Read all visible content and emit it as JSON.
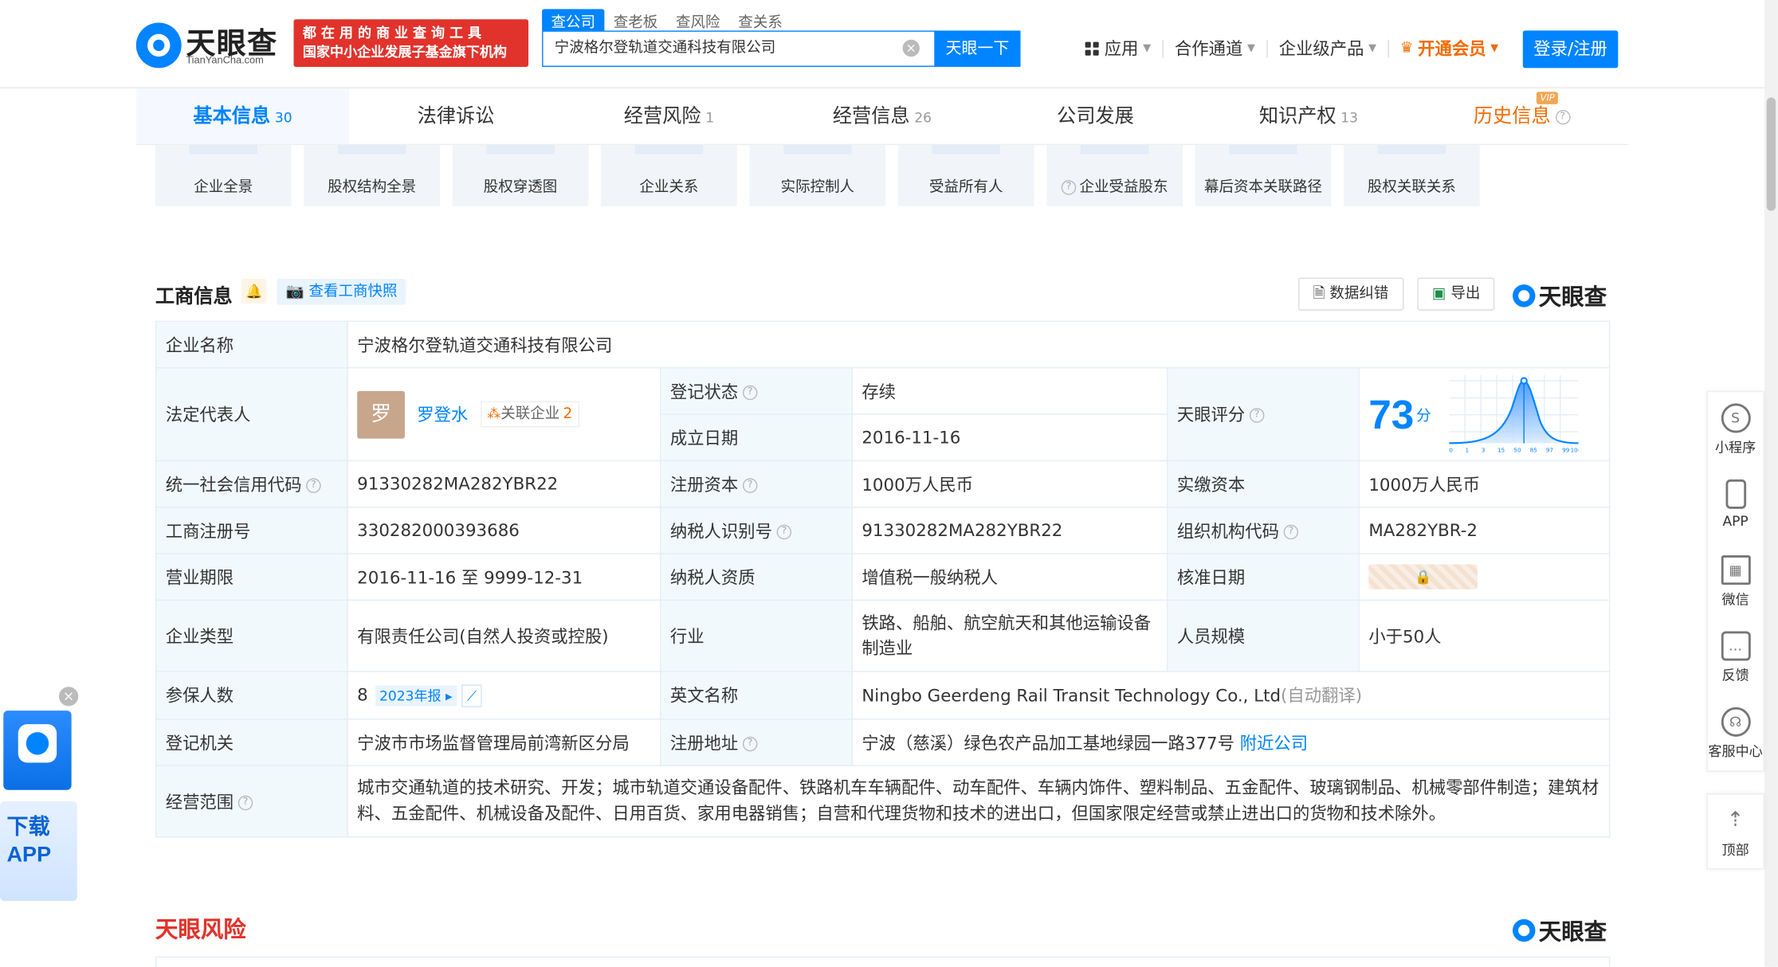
{
  "brand": {
    "name": "天眼查",
    "domain": "TianYanCha.com",
    "slogan_line1": "都 在 用 的 商 业 查 询 工 具",
    "slogan_line2": "国家中小企业发展子基金旗下机构"
  },
  "search": {
    "tabs": [
      "查公司",
      "查老板",
      "查风险",
      "查关系"
    ],
    "value": "宁波格尔登轨道交通科技有限公司",
    "button": "天眼一下"
  },
  "topnav": {
    "apps": "应用",
    "partner": "合作通道",
    "enterprise": "企业级产品",
    "vip": "开通会员",
    "login": "登录/注册"
  },
  "tabs": [
    {
      "label": "基本信息",
      "count": "30"
    },
    {
      "label": "法律诉讼",
      "count": ""
    },
    {
      "label": "经营风险",
      "count": "1"
    },
    {
      "label": "经营信息",
      "count": "26"
    },
    {
      "label": "公司发展",
      "count": ""
    },
    {
      "label": "知识产权",
      "count": "13"
    },
    {
      "label": "历史信息",
      "count": "",
      "badge": "VIP"
    }
  ],
  "quick": [
    "企业全景",
    "股权结构全景",
    "股权穿透图",
    "企业关系",
    "实际控制人",
    "受益所有人",
    "企业受益股东",
    "幕后资本关联路径",
    "股权关联关系"
  ],
  "section": {
    "title": "工商信息",
    "snapshot": "查看工商快照",
    "correct": "数据纠错",
    "export": "导出",
    "logo": "天眼查"
  },
  "info": {
    "company_name_label": "企业名称",
    "company_name": "宁波格尔登轨道交通科技有限公司",
    "legal_rep_label": "法定代表人",
    "legal_rep_avatar": "罗",
    "legal_rep": "罗登水",
    "related_label": "关联企业",
    "related_count": "2",
    "status_label": "登记状态",
    "status": "存续",
    "founded_label": "成立日期",
    "founded": "2016-11-16",
    "score_label": "天眼评分",
    "score": "73",
    "score_unit": "分",
    "credit_code_label": "统一社会信用代码",
    "credit_code": "91330282MA282YBR22",
    "reg_capital_label": "注册资本",
    "reg_capital": "1000万人民币",
    "paid_capital_label": "实缴资本",
    "paid_capital": "1000万人民币",
    "reg_no_label": "工商注册号",
    "reg_no": "330282000393686",
    "taxpayer_id_label": "纳税人识别号",
    "taxpayer_id": "91330282MA282YBR22",
    "org_code_label": "组织机构代码",
    "org_code": "MA282YBR-2",
    "term_label": "营业期限",
    "term": "2016-11-16 至 9999-12-31",
    "taxpayer_qual_label": "纳税人资质",
    "taxpayer_qual": "增值税一般纳税人",
    "approval_label": "核准日期",
    "type_label": "企业类型",
    "type": "有限责任公司(自然人投资或控股)",
    "industry_label": "行业",
    "industry": "铁路、船舶、航空航天和其他运输设备制造业",
    "staff_label": "人员规模",
    "staff": "小于50人",
    "insured_label": "参保人数",
    "insured": "8",
    "insured_report": "2023年报",
    "english_label": "英文名称",
    "english": "Ningbo Geerdeng Rail Transit Technology Co., Ltd",
    "english_note": "(自动翻译)",
    "authority_label": "登记机关",
    "authority": "宁波市市场监督管理局前湾新区分局",
    "address_label": "注册地址",
    "address": "宁波（慈溪）绿色农产品加工基地绿园一路377号",
    "nearby": "附近公司",
    "scope_label": "经营范围",
    "scope": "城市交通轨道的技术研究、开发；城市轨道交通设备配件、铁路机车车辆配件、动车配件、车辆内饰件、塑料制品、五金配件、玻璃钢制品、机械零部件制造；建筑材料、五金配件、机械设备及配件、日用百货、家用电器销售；自营和代理货物和技术的进出口，但国家限定经营或禁止进出口的货物和技术除外。"
  },
  "score_chart": {
    "x_ticks": [
      "0",
      "1",
      "3",
      "15",
      "50",
      "85",
      "97",
      "99",
      "100"
    ]
  },
  "side": {
    "mini": "小程序",
    "app": "APP",
    "wechat": "微信",
    "feedback": "反馈",
    "service": "客服中心",
    "top": "顶部"
  },
  "download": {
    "line1": "下载",
    "line2": "APP"
  },
  "risk": {
    "title": "天眼风险",
    "logo": "天眼查"
  }
}
